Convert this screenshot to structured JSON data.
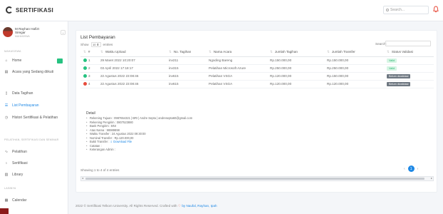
{
  "app": {
    "brand": "SERTIFIKASI"
  },
  "topbar": {
    "search_placeholder": "Search..."
  },
  "user": {
    "name_line1": "M Rayhan Hafizt",
    "name_line2": "Siregar",
    "role": "MAHASISWA"
  },
  "sidebar": {
    "section_main": "MAHASISWA",
    "items": [
      {
        "label": "Home",
        "icon": "home-icon"
      },
      {
        "label": "Acara yang Sedang diikuti",
        "icon": "book-icon"
      },
      {
        "label": "Data Tagihan",
        "icon": "document-icon"
      },
      {
        "label": "List Pembayaran",
        "icon": "list-icon"
      },
      {
        "label": "Histori Sertifikasi & Pelatihan",
        "icon": "clock-icon"
      }
    ],
    "section_events": "PELATIHAN, SERTIFIKASI DAN SEMINAR",
    "event_items": [
      {
        "label": "Pelatihan",
        "icon": "chart-icon"
      },
      {
        "label": "Sertifikasi",
        "icon": "award-icon"
      },
      {
        "label": "Library",
        "icon": "book-icon"
      }
    ],
    "section_other": "LAINNYA",
    "other_items": [
      {
        "label": "Calendar",
        "icon": "calendar-icon"
      }
    ]
  },
  "card": {
    "title": "List Pembayaran",
    "show_label": "Show",
    "show_value": "10",
    "entries_label": "entries",
    "search_label": "Search:"
  },
  "table": {
    "headers": [
      "#",
      "Waktu Upload",
      "No. Tagihan",
      "Nama Acara",
      "Jumlah Tagihan",
      "Jumlah Transfer",
      "Status Validasi"
    ],
    "rows": [
      {
        "no": "1",
        "waktu": "29 Maret 2022 10:20:07",
        "tagihan": "inv211",
        "acara": "Ngoding Bareng",
        "jumlah_tagihan": "Rp.150.000,00",
        "jumlah_transfer": "Rp.150.000,00",
        "status": "Valid",
        "dot_color": "#26c281"
      },
      {
        "no": "2",
        "waktu": "03 April 2022 17:18:17",
        "tagihan": "inv315",
        "acara": "Pelatihan Microsoft Azure",
        "jumlah_tagihan": "Rp.250.000,00",
        "jumlah_transfer": "Rp.250.000,00",
        "status": "Valid",
        "dot_color": "#26c281"
      },
      {
        "no": "3",
        "waktu": "22 Agustus 2022 23:08:46",
        "tagihan": "inv615",
        "acara": "Pelatihan VSGA",
        "jumlah_tagihan": "Rp.120.000,00",
        "jumlah_transfer": "Rp.150.000,00",
        "status": "Belum divalidasi",
        "dot_color": "#26c281"
      },
      {
        "no": "4",
        "waktu": "22 Agustus 2022 23:08:46",
        "tagihan": "inv615",
        "acara": "Pelatihan VSGA",
        "jumlah_tagihan": "Rp.120.000,00",
        "jumlah_transfer": "Rp.120.000,00",
        "status": "Belum divalidasi",
        "dot_color": "#e74c3c"
      }
    ]
  },
  "detail": {
    "title": "Detail",
    "lines": [
      "Rekening Tujuan : 0987654321 | BRI | Andre Septa | andresepta60@gmail.com",
      "Rekening Pengirim : 0807523880",
      "Bank Pengirim : BNI",
      "Atas Nama : 98989898",
      "Waktu Transfer : 24 Agustus 2022 09:30:00",
      "Nominal Transfer : Rp.120.000,00"
    ],
    "bukti_label": "Bukti Transfer :",
    "bukti_link": "Download File",
    "tail_lines": [
      "Catatan :",
      "Keterangan Admin :"
    ]
  },
  "pagination": {
    "info": "Showing 1 to 4 of 4 entries",
    "prev": "‹",
    "page": "1",
    "next": "›"
  },
  "footer": {
    "text": "2022 © Sertifikasi Telkom University. All Rights Reserved. Crafted with",
    "heart": "♡",
    "by": "by Naufal, Rayhan, Ipah"
  }
}
